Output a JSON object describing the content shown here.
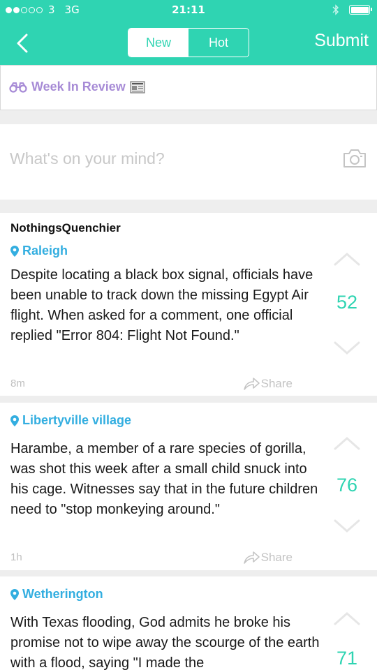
{
  "status_bar": {
    "signal_filled": 2,
    "signal_total": 5,
    "carrier": "3",
    "network": "3G",
    "time": "21:11"
  },
  "nav": {
    "tabs": [
      {
        "label": "New",
        "active": true
      },
      {
        "label": "Hot",
        "active": false
      }
    ],
    "submit_label": "Submit"
  },
  "week_review": {
    "label": "Week In Review"
  },
  "composer": {
    "placeholder": "What's on your mind?"
  },
  "posts": [
    {
      "author": "NothingsQuenchier",
      "location": "Raleigh",
      "text": "Despite locating a black box signal, officials have been unable to track down the missing Egypt Air flight. When asked for a comment, one official replied \"Error 804: Flight Not Found.\"",
      "time": "8m",
      "share_label": "Share",
      "votes": "52"
    },
    {
      "author": "",
      "location": "Libertyville village",
      "text": "Harambe, a member of a rare species of gorilla, was shot this week after a small child snuck into his cage. Witnesses say that in the future children need to \"stop monkeying around.\"",
      "time": "1h",
      "share_label": "Share",
      "votes": "76"
    },
    {
      "author": "",
      "location": "Wetherington",
      "text": "With Texas flooding, God admits he broke his promise not to wipe away the scourge of the earth with a flood, saying \"I made the",
      "time": "",
      "share_label": "",
      "votes": "71"
    }
  ],
  "colors": {
    "brand": "#2fd4b2",
    "location": "#33aee0",
    "week_review": "#a78bd6"
  }
}
